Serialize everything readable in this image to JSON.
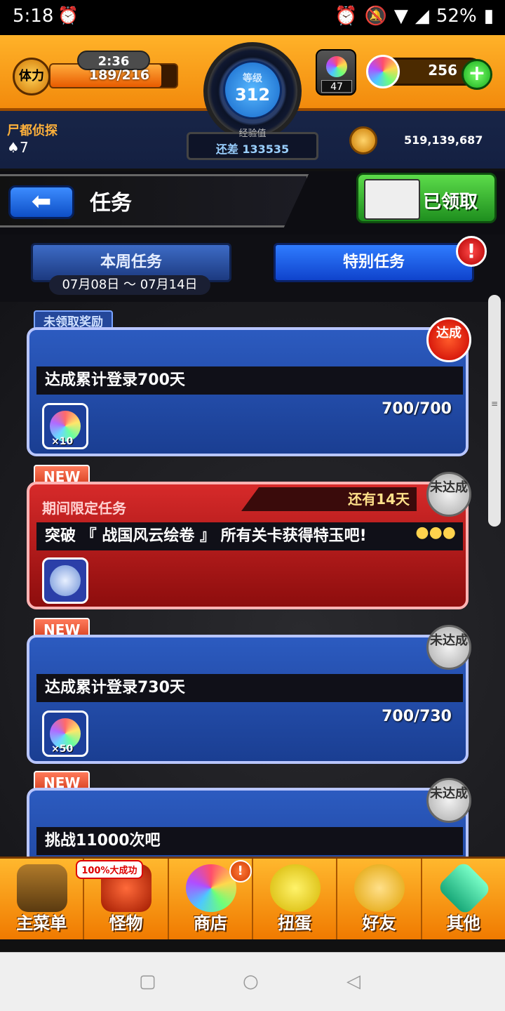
{
  "status_bar": {
    "time": "5:18",
    "battery": "52%"
  },
  "hud": {
    "stamina_label": "体力",
    "stamina_timer": "2:36",
    "stamina_value": "189/216",
    "stamina_fraction": 0.875,
    "level_label": "等级",
    "level_value": "312",
    "exp_label": "经验值",
    "exp_remaining": "还差 133535",
    "gacha_count": "47",
    "orb_count": "256",
    "plus_label": "+",
    "player_name": "尸都侦探",
    "rank": "7",
    "coins": "519,139,687"
  },
  "header": {
    "back_label": "⬅",
    "title": "任务",
    "claimed_label": "已领取"
  },
  "tabs": {
    "weekly": "本周任务",
    "weekly_dates": "07月08日 ～ 07月14日",
    "special": "特别任务",
    "alert": "!"
  },
  "missions": [
    {
      "tag": "未领取奖励",
      "title": "达成累计登录700天",
      "progress": "700/700",
      "reward_qty": "×10",
      "stamp": "达成"
    },
    {
      "tag": "NEW",
      "limited_label": "期间限定任务",
      "remaining": "还有14天",
      "title": "突破 『 战国风云绘卷 』 所有关卡获得特玉吧!",
      "stamp": "未达成"
    },
    {
      "tag": "NEW",
      "title": "达成累计登录730天",
      "progress": "700/730",
      "reward_qty": "×50",
      "stamp": "未达成"
    },
    {
      "tag": "NEW",
      "title": "挑战11000次吧",
      "stamp": "未达成"
    }
  ],
  "bottom_nav": {
    "main_menu": "主菜单",
    "monster": "怪物",
    "monster_badge": "100%大成功",
    "shop": "商店",
    "shop_alert": "!",
    "gacha": "扭蛋",
    "friends": "好友",
    "other": "其他"
  }
}
